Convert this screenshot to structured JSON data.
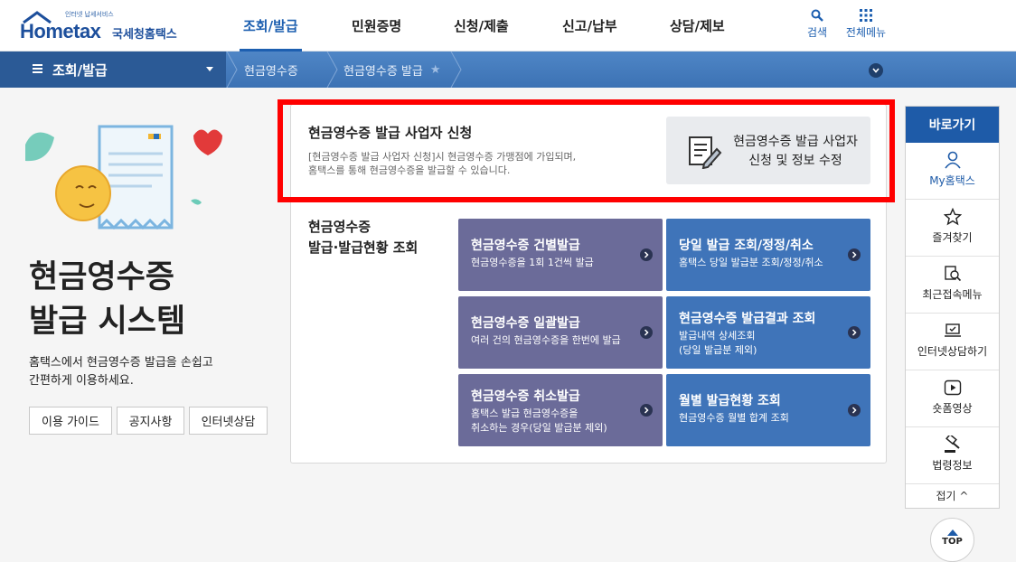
{
  "header": {
    "logo_tagline": "인터넷 납세서비스",
    "logo_brand": "Hometax",
    "logo_name": "국세청홈택스",
    "nav": [
      "조회/발급",
      "민원증명",
      "신청/제출",
      "신고/납부",
      "상담/제보"
    ],
    "active_nav": "조회/발급",
    "search_label": "검색",
    "all_menu_label": "전체메뉴"
  },
  "breadcrumb": {
    "menu_label": "조회/발급",
    "items": [
      "현금영수증",
      "현금영수증 발급"
    ]
  },
  "hero": {
    "title_line1": "현금영수증",
    "title_line2": "발급 시스템",
    "desc_line1": "홈택스에서 현금영수증 발급을 손쉽고",
    "desc_line2": "간편하게 이용하세요.",
    "buttons": [
      "이용 가이드",
      "공지사항",
      "인터넷상담"
    ]
  },
  "apply": {
    "title": "현금영수증 발급 사업자 신청",
    "desc_line1": "[현금영수증 발급 사업자 신청]시 현금영수증 가맹점에 가입되며,",
    "desc_line2": "홈택스를 통해 현금영수증을 발급할 수 있습니다.",
    "button_line1": "현금영수증 발급 사업자",
    "button_line2": "신청 및 정보 수정"
  },
  "section": {
    "title_line1": "현금영수증",
    "title_line2": "발급·발급현황 조회"
  },
  "tiles": [
    {
      "title": "현금영수증 건별발급",
      "desc": [
        "현금영수증을 1회 1건씩 발급"
      ]
    },
    {
      "title": "당일 발급 조회/정정/취소",
      "desc": [
        "홈택스 당일 발급분 조회/정정/취소"
      ]
    },
    {
      "title": "현금영수증 일괄발급",
      "desc": [
        "여러 건의 현금영수증을 한번에 발급"
      ]
    },
    {
      "title": "현금영수증 발급결과 조회",
      "desc": [
        "발급내역 상세조회",
        "(당일 발급분 제외)"
      ]
    },
    {
      "title": "현금영수증 취소발급",
      "desc": [
        "홈택스 발급 현금영수증을",
        "취소하는 경우(당일 발급분 제외)"
      ]
    },
    {
      "title": "월별 발급현황 조회",
      "desc": [
        "현금영수증 월별 합계 조회"
      ]
    }
  ],
  "quick": {
    "head": "바로가기",
    "items": [
      "My홈택스",
      "즐겨찾기",
      "최근접속메뉴",
      "인터넷상담하기",
      "숏폼영상",
      "법령정보"
    ],
    "fold": "접기 ^",
    "top": "TOP"
  },
  "colors": {
    "brand_blue": "#1d5fb0",
    "tile_purple": "#6b6b99",
    "tile_blue": "#3f74b9",
    "highlight_red": "#ff0000"
  }
}
